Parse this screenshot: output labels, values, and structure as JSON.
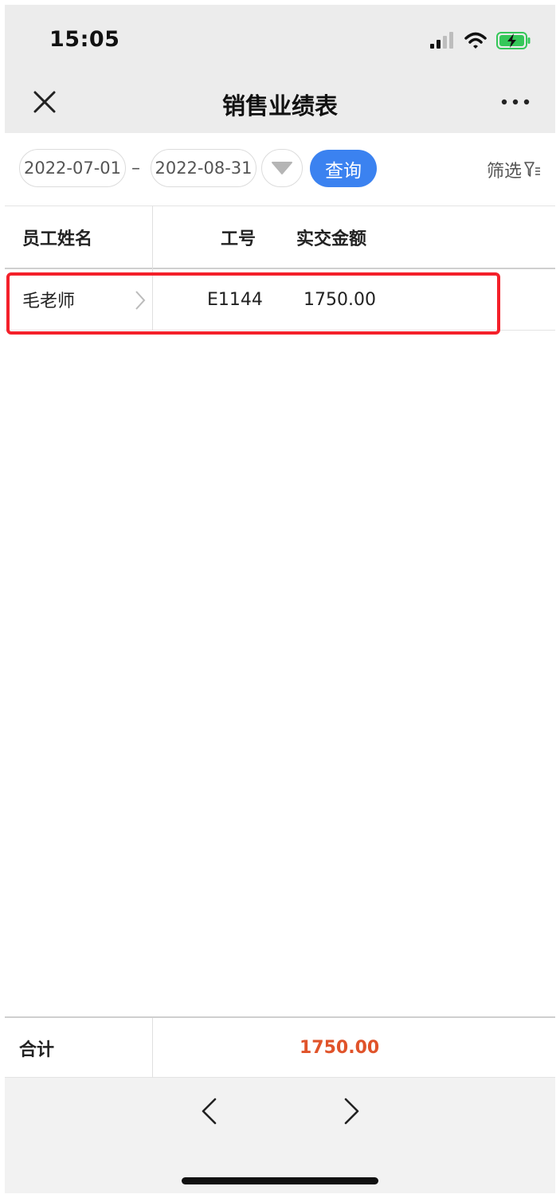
{
  "status_bar": {
    "time": "15:05"
  },
  "navbar": {
    "title": "销售业绩表"
  },
  "filter": {
    "start_date": "2022-07-01",
    "separator": "–",
    "end_date": "2022-08-31",
    "query_label": "查询",
    "screen_label": "筛选"
  },
  "table": {
    "columns": [
      "员工姓名",
      "工号",
      "实交金额"
    ],
    "rows": [
      {
        "name": "毛老师",
        "employee_id": "E1144",
        "amount": "1750.00"
      }
    ]
  },
  "summary": {
    "label": "合计",
    "total": "1750.00"
  },
  "colors": {
    "accent": "#3b82f0",
    "total": "#e0532a",
    "highlight": "#f4202a"
  }
}
